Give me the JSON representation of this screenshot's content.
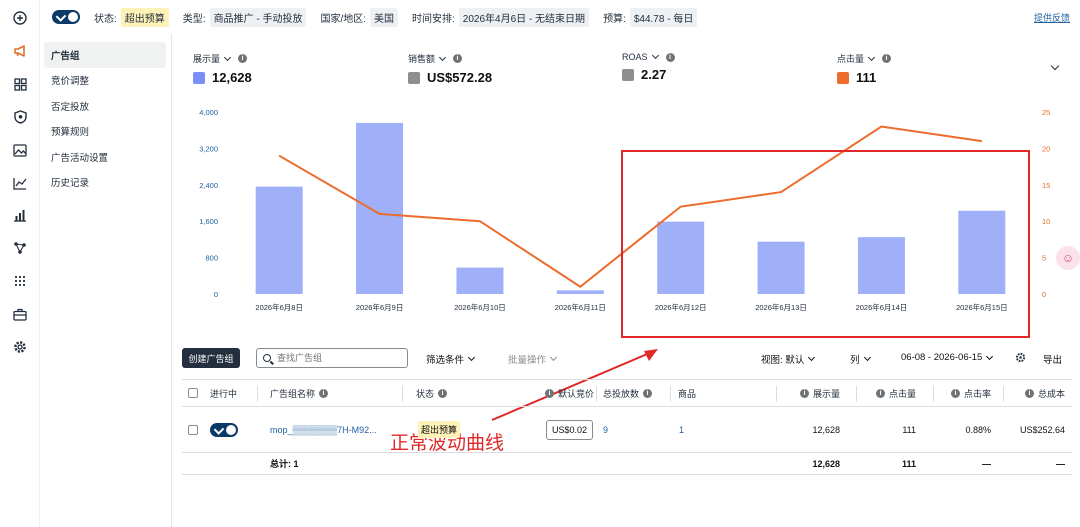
{
  "topbar": {
    "status_label": "状态:",
    "status_value": "超出预算",
    "type_label": "类型:",
    "type_value": "商品推广 - 手动投放",
    "country_label": "国家/地区:",
    "country_value": "美国",
    "schedule_label": "时间安排:",
    "schedule_value": "2026年4月6日 - 无结束日期",
    "budget_label": "预算:",
    "budget_value": "$44.78 - 每日",
    "feedback": "提供反馈"
  },
  "rail_icons": [
    "plus-circle-icon",
    "megaphone-icon",
    "grid-icon",
    "shield-icon",
    "image-icon",
    "line-chart-icon",
    "bar-chart-icon",
    "network-icon",
    "apps-icon",
    "briefcase-icon",
    "settings-icon"
  ],
  "subnav": {
    "items": [
      "广告组",
      "竞价调整",
      "否定投放",
      "预算规则",
      "广告活动设置",
      "历史记录"
    ],
    "active_index": 0
  },
  "metrics": [
    {
      "label": "展示量",
      "value": "12,628",
      "color": "#7b8ff7"
    },
    {
      "label": "销售额",
      "value": "US$572.28",
      "color": "#8e8e8e"
    },
    {
      "label": "ROAS",
      "value": "2.27",
      "color": "#8e8e8e"
    },
    {
      "label": "点击量",
      "value": "111",
      "color": "#ec6b2d"
    }
  ],
  "chart_data": {
    "type": "bar+line",
    "categories": [
      "2026年6月8日",
      "2026年6月9日",
      "2026年6月10日",
      "2026年6月11日",
      "2026年6月12日",
      "2026年6月13日",
      "2026年6月14日",
      "2026年6月15日"
    ],
    "series": [
      {
        "name": "展示量",
        "type": "bar",
        "axis": "left",
        "color": "#9fb0f9",
        "values": [
          2360,
          3760,
          580,
          80,
          1590,
          1150,
          1250,
          1830
        ]
      },
      {
        "name": "点击量",
        "type": "line",
        "axis": "right",
        "color": "#ec6b2d",
        "values": [
          19,
          11,
          10,
          1,
          12,
          14,
          23,
          21
        ]
      }
    ],
    "left_ticks": [
      "0",
      "800",
      "1,600",
      "2,400",
      "3,200",
      "4,000"
    ],
    "right_ticks": [
      "0",
      "5",
      "10",
      "15",
      "20",
      "25"
    ],
    "ylim_left": [
      0,
      4000
    ],
    "ylim_right": [
      0,
      25
    ]
  },
  "annotation": {
    "text": "正常波动曲线"
  },
  "toolbar": {
    "create_button": "创建广告组",
    "search_placeholder": "查找广告组",
    "filter": "筛选条件",
    "bulk": "批量操作",
    "view": "视图: 默认",
    "columns": "列",
    "date_range": "06-08 - 2026-06-15",
    "export": "导出"
  },
  "table": {
    "headers": {
      "active": "进行中",
      "name": "广告组名称",
      "status": "状态",
      "default_bid": "默认竞价",
      "total_targets": "总投放数",
      "products": "商品",
      "impressions": "展示量",
      "clicks": "点击量",
      "ctr": "点击率",
      "cost": "总成本"
    },
    "row": {
      "name": "mop_▒▒▒▒▒▒▒7H-M92...",
      "status": "超出预算",
      "default_bid": "US$0.02",
      "total_targets": "9",
      "products": "1",
      "impressions": "12,628",
      "clicks": "111",
      "ctr": "0.88%",
      "cost": "US$252.64"
    },
    "footer": {
      "label": "总计: 1",
      "impressions": "12,628",
      "clicks": "111",
      "ctr": "—",
      "cost": "—"
    }
  }
}
